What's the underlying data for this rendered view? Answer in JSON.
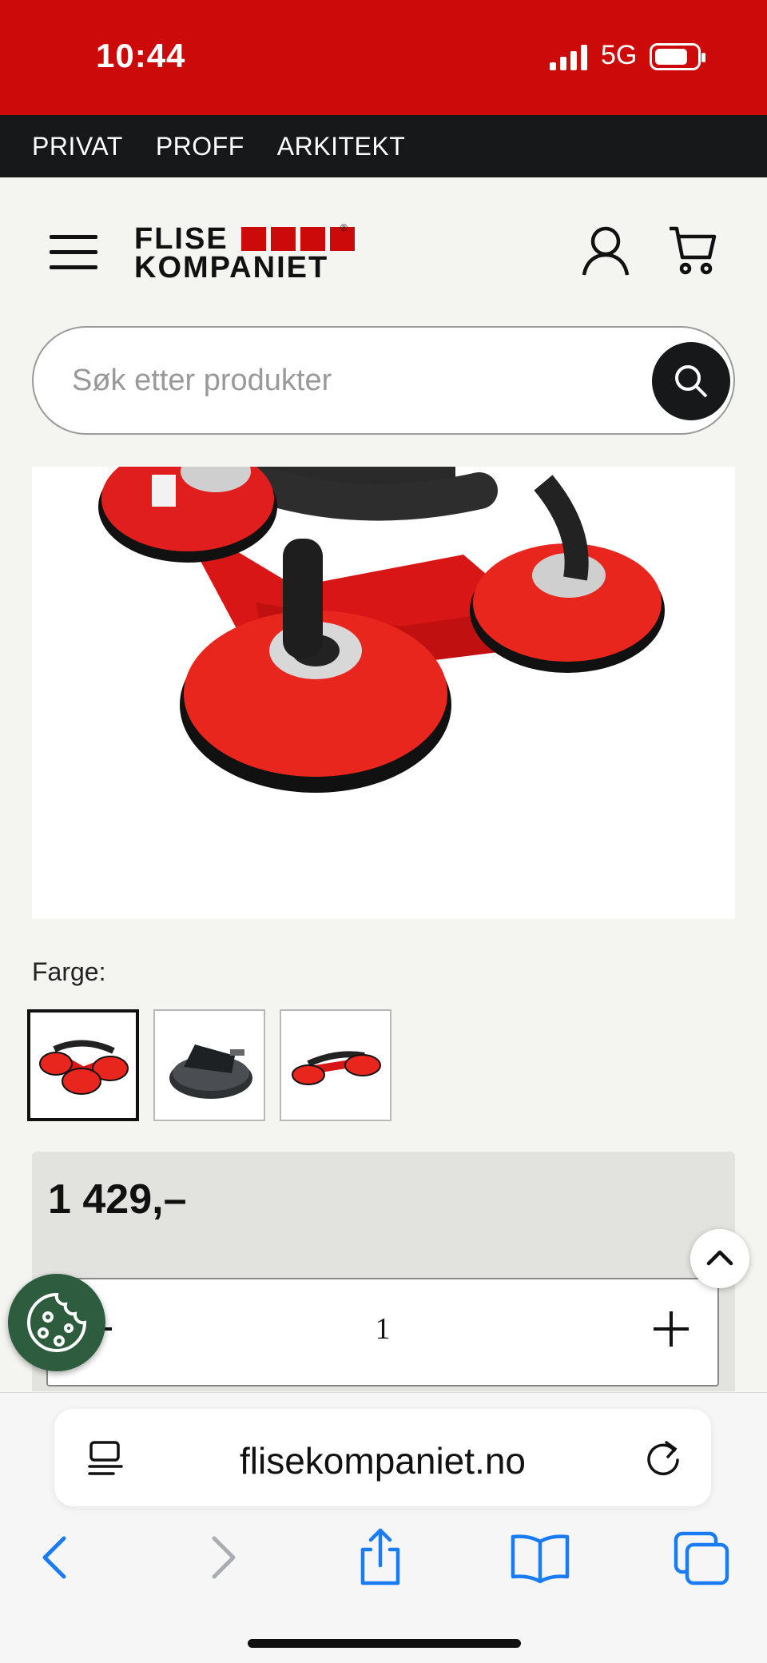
{
  "status_bar": {
    "time": "10:44",
    "network": "5G"
  },
  "segment_nav": {
    "items": [
      "PRIVAT",
      "PROFF",
      "ARKITEKT"
    ]
  },
  "header": {
    "logo_line1": "FLISE",
    "logo_line2": "KOMPANIET",
    "logo_reg": "®"
  },
  "search": {
    "placeholder": "Søk etter produkter",
    "value": ""
  },
  "product": {
    "color_label": "Farge:",
    "price": "1 429,–",
    "quantity": "1",
    "quantity_minus": "–"
  },
  "browser": {
    "url": "flisekompaniet.no"
  },
  "colors": {
    "brand_red": "#cc0a0a",
    "nav_dark": "#16181a",
    "cookie_green": "#2e5c3e",
    "ios_blue": "#1a7cf5"
  }
}
